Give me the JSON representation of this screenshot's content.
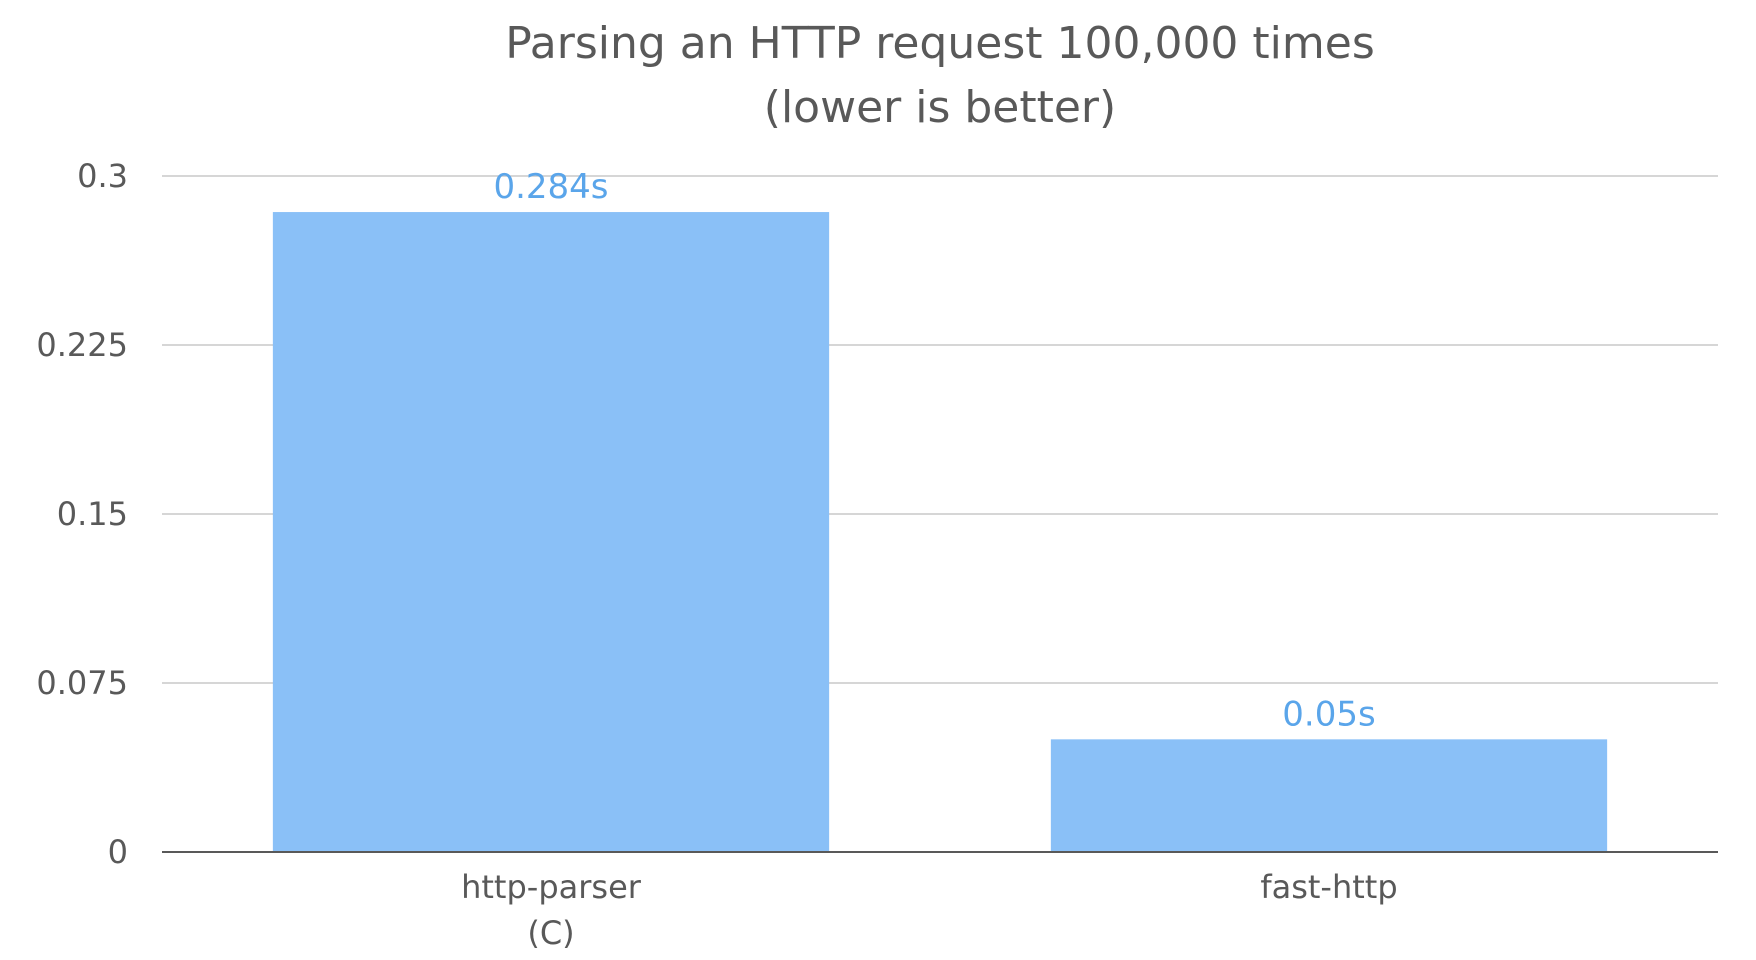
{
  "chart_data": {
    "type": "bar",
    "title": "Parsing an HTTP request 100,000 times",
    "subtitle": "(lower is better)",
    "categories": [
      [
        "http-parser",
        "(C)"
      ],
      [
        "fast-http"
      ]
    ],
    "values": [
      0.284,
      0.05
    ],
    "data_labels": [
      "0.284s",
      "0.05s"
    ],
    "ylim": [
      0,
      0.3
    ],
    "yticks": [
      0,
      0.075,
      0.15,
      0.225,
      0.3
    ],
    "ytick_labels": [
      "0",
      "0.075",
      "0.15",
      "0.225",
      "0.3"
    ],
    "xlabel": "",
    "ylabel": "",
    "grid": true,
    "legend": "none",
    "bar_color": "#8AC0F7",
    "label_color": "#5AA5EA",
    "text_color": "#595959"
  }
}
